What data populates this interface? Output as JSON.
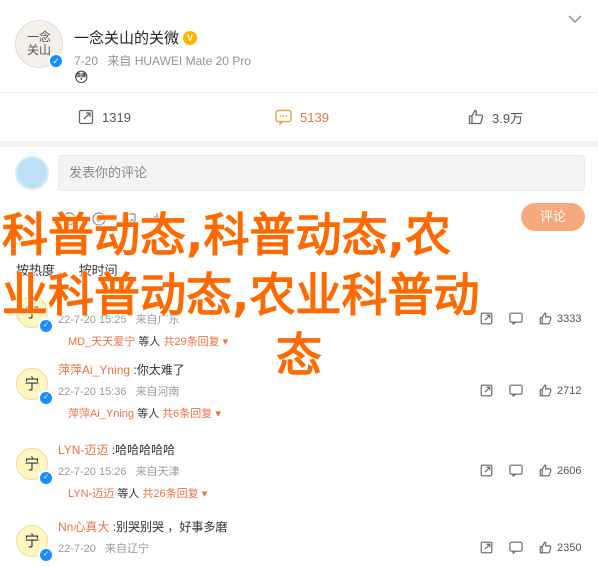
{
  "post": {
    "author_name": "一念关山的关微",
    "author_avatar_text": "一念\n关山",
    "vip_badge": "V",
    "verified_mark": "✓",
    "time": "7-20",
    "source": "来自 HUAWEI Mate 20 Pro",
    "emoji": "😳",
    "expand_icon": "chevron-down-icon",
    "actions": {
      "share_count": "1319",
      "comment_count": "5139",
      "like_count": "3.9万"
    }
  },
  "composer": {
    "placeholder": "发表你的评论",
    "submit_label": "评论",
    "sort_hot": "按热度",
    "sort_time": "按时间"
  },
  "comments": [
    {
      "avatar_text": "宁",
      "username": "",
      "text": "",
      "time": "22-7-20 15:25",
      "location": "来自广东",
      "like_count": "3333",
      "reply_user": "MD_天天爱宁",
      "reply_text": "等人",
      "reply_more": "共29条回复"
    },
    {
      "avatar_text": "宁",
      "username": "萍萍Ai_Yning",
      "text": ":你太难了",
      "time": "22-7-20 15:36",
      "location": "来自河南",
      "like_count": "2712",
      "reply_user": "萍萍Ai_Yning",
      "reply_text": "等人",
      "reply_more": "共6条回复"
    },
    {
      "avatar_text": "宁",
      "username": "LYN-迈迈",
      "text": ":哈哈哈哈哈",
      "time": "22-7-20 15:26",
      "location": "来自天津",
      "like_count": "2606",
      "reply_user": "LYN-迈迈",
      "reply_text": "等人",
      "reply_more": "共26条回复"
    },
    {
      "avatar_text": "宁",
      "username": "Nn心真大",
      "text": ":别哭别哭 ，好事多磨",
      "time": "22-7-20",
      "location": "来自辽宁",
      "like_count": "2350",
      "reply_user": "",
      "reply_text": "",
      "reply_more": ""
    }
  ],
  "overlay": {
    "line1": "科普动态,科普动态,农",
    "line2": "业科普动态,农业科普动",
    "line3": "态"
  },
  "colors": {
    "accent": "#eb7340",
    "overlay": "#ff6a00",
    "verified": "#1a8cff",
    "submit": "#f7a97e"
  }
}
